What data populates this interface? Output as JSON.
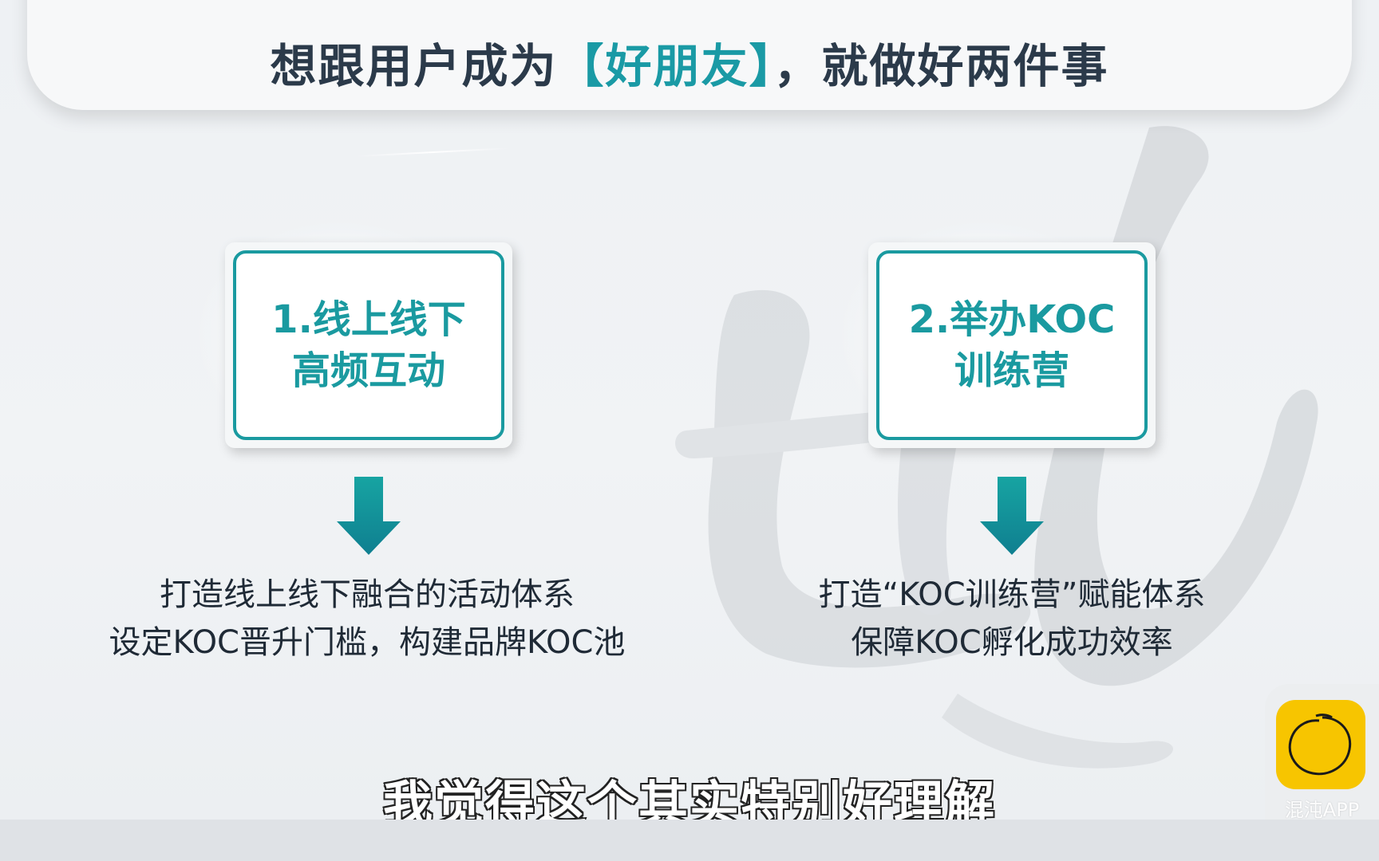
{
  "header": {
    "title_prefix": "想跟用户成为",
    "title_accent": "【好朋友】",
    "title_suffix": "，就做好两件事"
  },
  "cards": [
    {
      "title": "1.线上线下\n高频互动",
      "desc": [
        "打造线上线下融合的活动体系",
        "设定KOC晋升门槛，构建品牌KOC池"
      ]
    },
    {
      "title": "2.举办KOC\n训练营",
      "desc": [
        "打造“KOC训练营”赋能体系",
        "保障KOC孵化成功效率"
      ]
    }
  ],
  "subtitle": "我觉得这个其实特别好理解",
  "watermark": {
    "label": "混沌APP",
    "icon": "hundun-logo-icon"
  },
  "colors": {
    "accent": "#1a9aa0",
    "title": "#2b3a4a",
    "logo": "#f7c500"
  }
}
